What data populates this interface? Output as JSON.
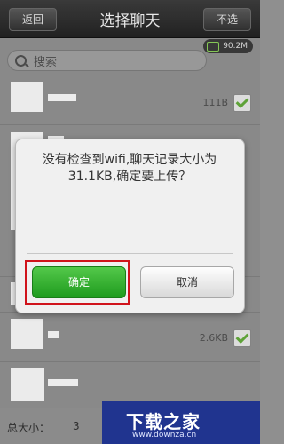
{
  "header": {
    "back": "返回",
    "title": "选择聊天",
    "deselect": "不选",
    "memory": "90.2M"
  },
  "search": {
    "placeholder": "搜索"
  },
  "list": [
    {
      "size": "111B"
    },
    {
      "size": ""
    },
    {
      "size": ""
    },
    {
      "size": "2.6KB"
    },
    {
      "size": ""
    }
  ],
  "dialog": {
    "message": "没有检查到wifi,聊天记录大小为31.1KB,确定要上传？",
    "confirm": "确定",
    "cancel": "取消"
  },
  "footer": {
    "label": "总大小：",
    "value": "3"
  },
  "watermark": {
    "main": "下载之家",
    "sub": "www.downza.cn"
  }
}
